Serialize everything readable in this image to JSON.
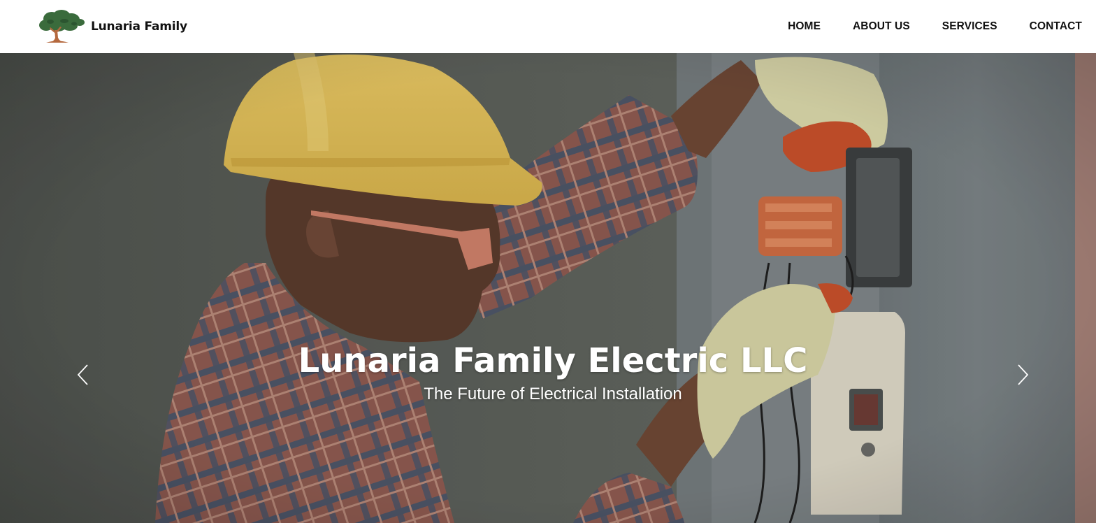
{
  "brand": {
    "name": "Lunaria Family",
    "logo_icon": "tree-icon"
  },
  "nav": {
    "items": [
      {
        "label": "HOME"
      },
      {
        "label": "ABOUT US"
      },
      {
        "label": "SERVICES"
      },
      {
        "label": "CONTACT"
      }
    ]
  },
  "hero": {
    "title": "Lunaria Family Electric LLC",
    "subtitle": "The Future of Electrical Installation",
    "prev_icon": "chevron-left-icon",
    "next_icon": "chevron-right-icon",
    "image": "photo of electrician in yellow hard hat working on wall switch box"
  },
  "colors": {
    "nav_background": "#ffffff",
    "nav_text": "#111111",
    "hero_text": "#ffffff",
    "logo_tree_green": "#3a6b3c",
    "logo_trunk": "#b5693e"
  }
}
